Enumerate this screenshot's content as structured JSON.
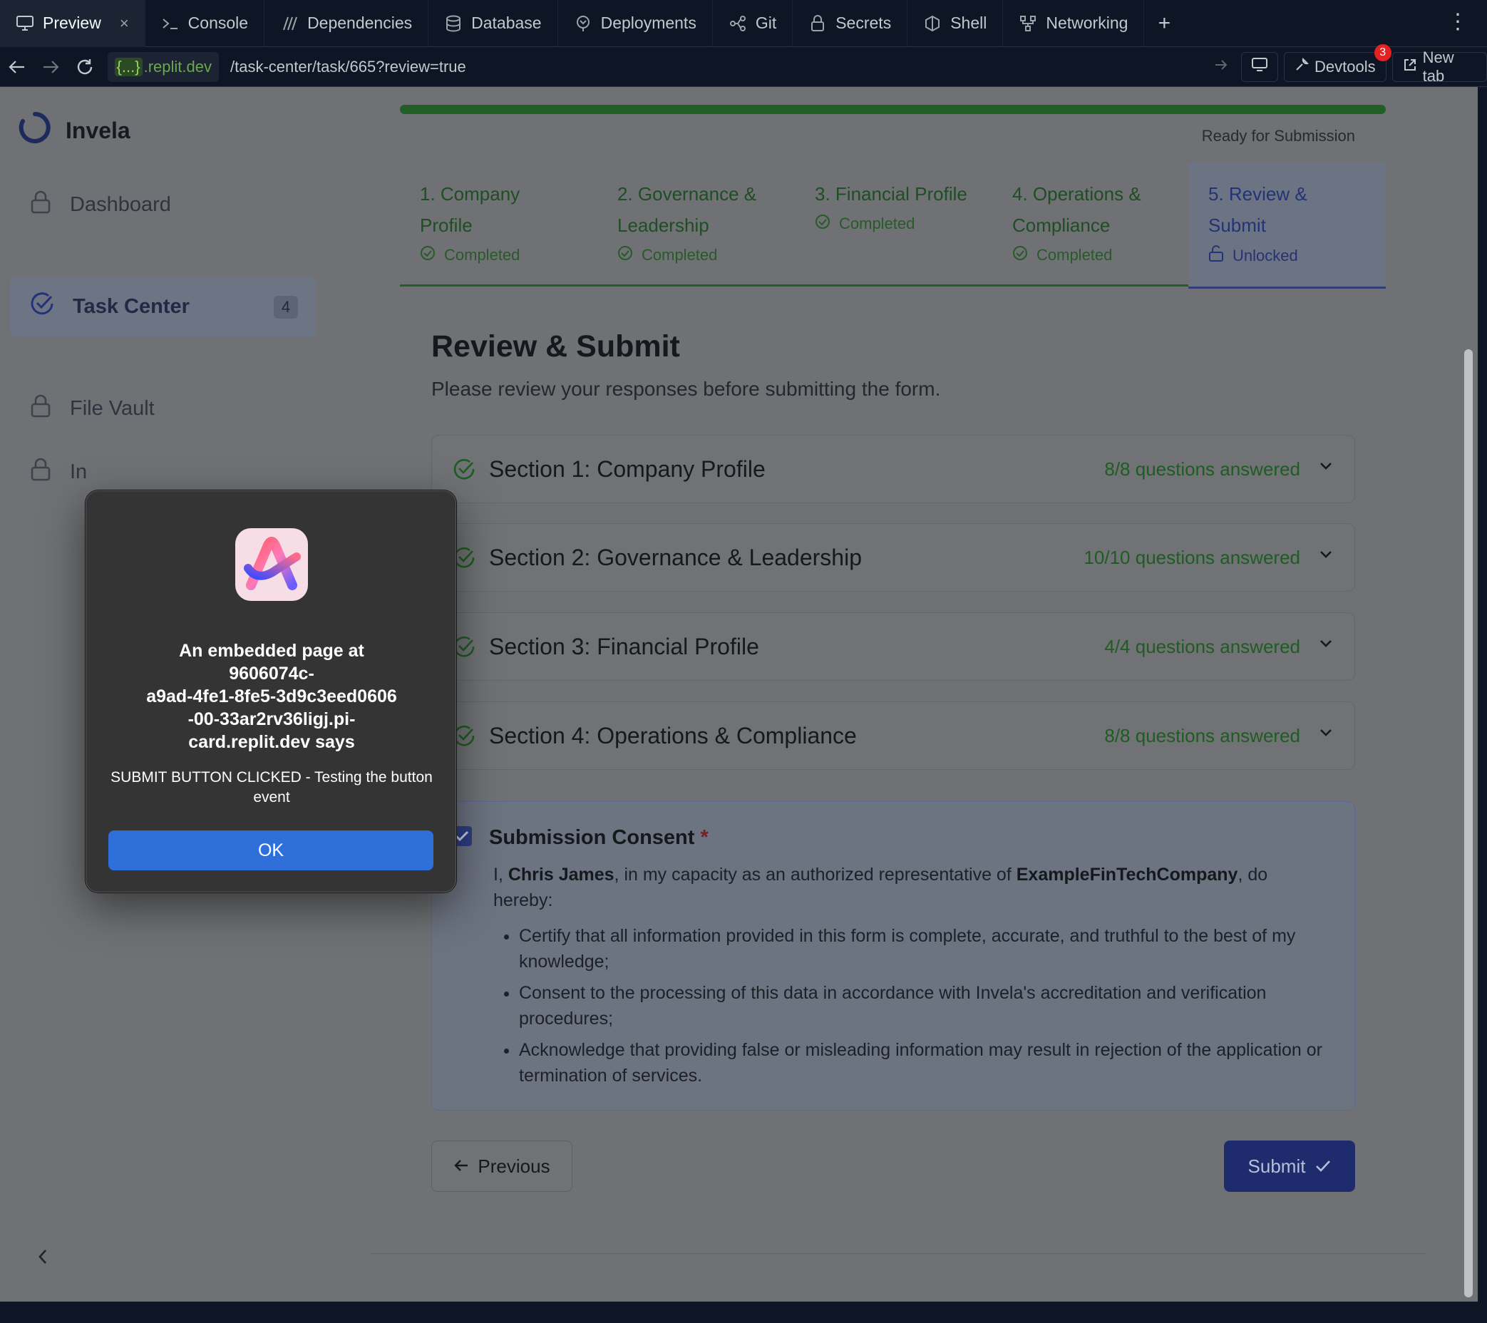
{
  "tabs": [
    {
      "label": "Preview",
      "icon": "monitor-icon"
    },
    {
      "label": "Console",
      "icon": "terminal-icon"
    },
    {
      "label": "Dependencies",
      "icon": "dependencies-icon"
    },
    {
      "label": "Database",
      "icon": "database-icon"
    },
    {
      "label": "Deployments",
      "icon": "deployments-icon"
    },
    {
      "label": "Git",
      "icon": "git-icon"
    },
    {
      "label": "Secrets",
      "icon": "lock-icon"
    },
    {
      "label": "Shell",
      "icon": "shell-icon"
    },
    {
      "label": "Networking",
      "icon": "network-icon"
    }
  ],
  "address": {
    "host_brace": "{...}",
    "host": ".replit.dev",
    "path": "/task-center/task/665?review=true",
    "devtools_label": "Devtools",
    "devtools_badge": "3",
    "new_tab_label": "New tab"
  },
  "app": {
    "name": "Invela"
  },
  "sidebar": {
    "items": [
      {
        "label": "Dashboard"
      },
      {
        "label": "Task Center",
        "count": "4"
      },
      {
        "label": "File Vault"
      },
      {
        "label": "In"
      }
    ]
  },
  "progress": {
    "status": "Ready for Submission",
    "fraction": 1.0
  },
  "steps": [
    {
      "title_l1": "1. Company",
      "title_l2": "Profile",
      "status": "Completed"
    },
    {
      "title_l1": "2. Governance &",
      "title_l2": "Leadership",
      "status": "Completed"
    },
    {
      "title_l1": "3. Financial Profile",
      "title_l2": "",
      "status": "Completed"
    },
    {
      "title_l1": "4. Operations &",
      "title_l2": "Compliance",
      "status": "Completed"
    },
    {
      "title_l1": "5. Review &",
      "title_l2": "Submit",
      "status": "Unlocked"
    }
  ],
  "review": {
    "title": "Review & Submit",
    "subtitle": "Please review your responses before submitting the form.",
    "sections": [
      {
        "title": "Section 1: Company Profile",
        "answered": "8/8 questions answered"
      },
      {
        "title": "Section 2: Governance & Leadership",
        "answered": "10/10 questions answered"
      },
      {
        "title": "Section 3: Financial Profile",
        "answered": "4/4 questions answered"
      },
      {
        "title": "Section 4: Operations & Compliance",
        "answered": "8/8 questions answered"
      }
    ]
  },
  "consent": {
    "title": "Submission Consent",
    "required_mark": "*",
    "intro_1": "I, ",
    "name": "Chris James",
    "intro_2": ", in my capacity as an authorized representative of ",
    "company": "ExampleFinTechCompany",
    "intro_3": ", do hereby:",
    "bullets": [
      "Certify that all information provided in this form is complete, accurate, and truthful to the best of my knowledge;",
      "Consent to the processing of this data in accordance with Invela's accreditation and verification procedures;",
      "Acknowledge that providing false or misleading information may result in rejection of the application or termination of services."
    ],
    "checked": true
  },
  "buttons": {
    "previous": "Previous",
    "submit": "Submit"
  },
  "dialog": {
    "title": "An embedded page at 9606074c-a9ad-4fe1-8fe5-3d9c3eed0606-00-33ar2rv36ligj.pi-card.replit.dev says",
    "title_lines": [
      "An embedded page at",
      "9606074c-",
      "a9ad-4fe1-8fe5-3d9c3eed0606",
      "-00-33ar2rv36ligj.pi-",
      "card.replit.dev says"
    ],
    "message": "SUBMIT BUTTON CLICKED - Testing the button event",
    "ok": "OK"
  },
  "colors": {
    "accent_green": "#215f26",
    "accent_blue": "#1e2c6e",
    "ok_blue": "#2e6fd9",
    "badge_red": "#e52222"
  }
}
